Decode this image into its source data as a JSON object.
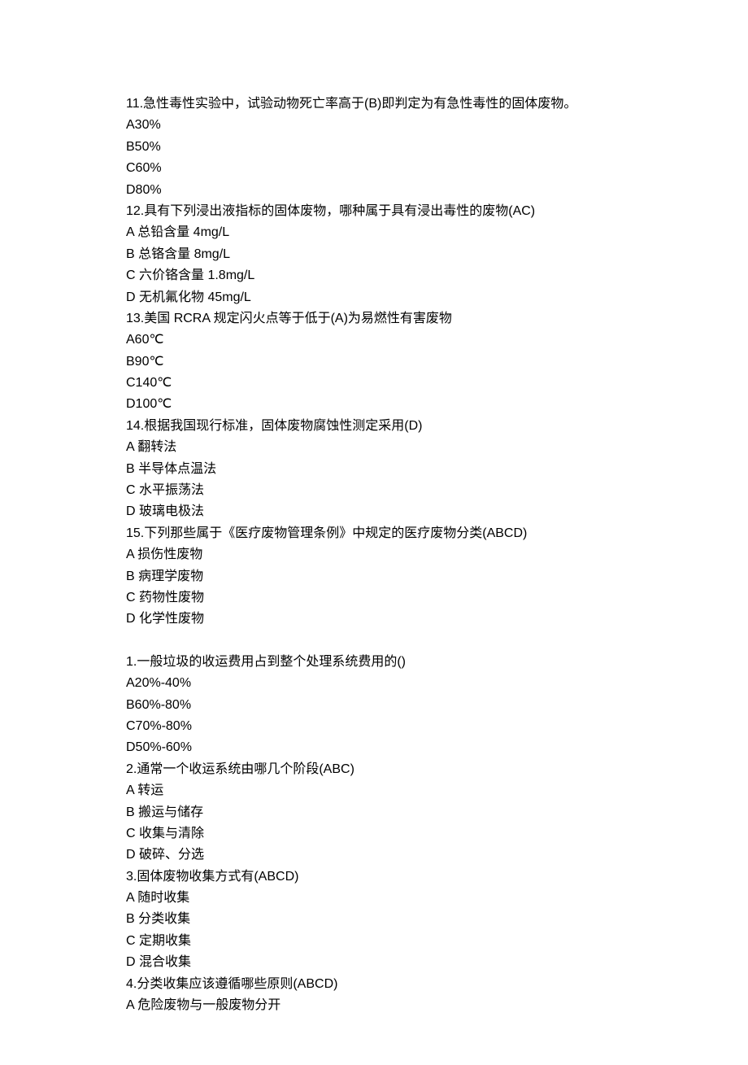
{
  "questions": [
    {
      "stem": "11.急性毒性实验中，试验动物死亡率高于(B)即判定为有急性毒性的固体废物。",
      "options": [
        "A30%",
        "B50%",
        "C60%",
        "D80%"
      ]
    },
    {
      "stem": "12.具有下列浸出液指标的固体废物，哪种属于具有浸出毒性的废物(AC)",
      "options": [
        "A 总铅含量 4mg/L",
        "B 总铬含量 8mg/L",
        "C 六价铬含量 1.8mg/L",
        "D 无机氟化物 45mg/L"
      ]
    },
    {
      "stem": "13.美国 RCRA 规定闪火点等于低于(A)为易燃性有害废物",
      "options": [
        "A60℃",
        "B90℃",
        "C140℃",
        "D100℃"
      ]
    },
    {
      "stem": "14.根据我国现行标准，固体废物腐蚀性测定采用(D)",
      "options": [
        "A 翻转法",
        "B 半导体点温法",
        "C 水平振荡法",
        "D 玻璃电极法"
      ]
    },
    {
      "stem": "15.下列那些属于《医疗废物管理条例》中规定的医疗废物分类(ABCD)",
      "options": [
        "A 损伤性废物",
        "B 病理学废物",
        "C 药物性废物",
        "D 化学性废物"
      ]
    }
  ],
  "questions2": [
    {
      "stem": "1.一般垃圾的收运费用占到整个处理系统费用的()",
      "options": [
        "A20%-40%",
        "B60%-80%",
        "C70%-80%",
        "D50%-60%"
      ]
    },
    {
      "stem": "2.通常一个收运系统由哪几个阶段(ABC)",
      "options": [
        "A 转运",
        "B 搬运与储存",
        "C 收集与清除",
        "D 破碎、分选"
      ]
    },
    {
      "stem": "3.固体废物收集方式有(ABCD)",
      "options": [
        "A 随时收集",
        "B 分类收集",
        "C 定期收集",
        "D 混合收集"
      ]
    },
    {
      "stem": "4.分类收集应该遵循哪些原则(ABCD)",
      "options": [
        "A 危险废物与一般废物分开"
      ]
    }
  ]
}
